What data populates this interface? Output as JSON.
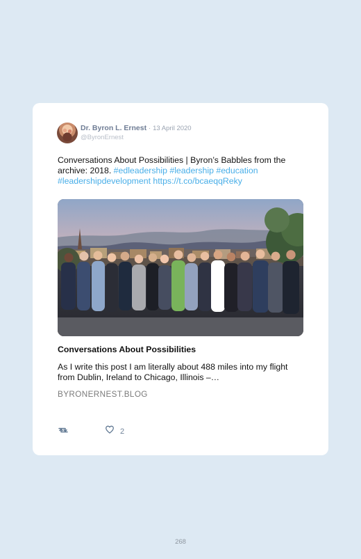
{
  "tweet": {
    "author_name": "Dr. Byron L. Ernest",
    "separator": "·",
    "date": "13 April 2020",
    "handle": "@ByronErnest",
    "text_prefix": "Conversations About Possibilities | Byron’s Babbles from the archive: 2018.",
    "hashtag_1": "#edleadership",
    "hashtag_2": "#leadership",
    "hashtag_3": "#education",
    "hashtag_4": "#leadershipdevelopment",
    "link": "https://t.co/bcaeqqReky"
  },
  "preview": {
    "title": "Conversations About Possibilities",
    "description": "As I write this post I am literally about 488 miles into my flight from Dublin, Ireland to Chicago, Illinois –…",
    "domain": "BYRONERNEST.BLOG"
  },
  "actions": {
    "like_count": "2"
  },
  "page": {
    "number": "268"
  },
  "icons": {
    "retweet": "retweet-icon",
    "like": "heart-icon"
  },
  "colors": {
    "page_background": "#dde9f3",
    "card_background": "#ffffff",
    "link": "#48aee8",
    "author": "#6f7d95"
  }
}
